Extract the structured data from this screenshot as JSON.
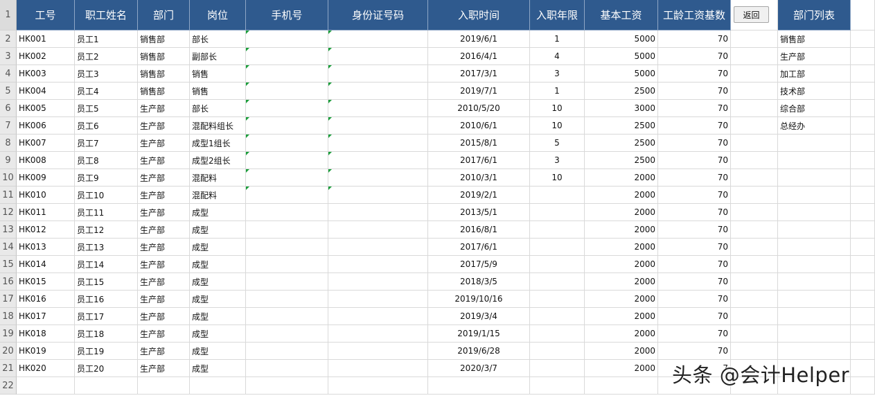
{
  "headers": [
    "工号",
    "职工姓名",
    "部门",
    "岗位",
    "手机号",
    "身份证号码",
    "入职时间",
    "入职年限",
    "基本工资",
    "工龄工资基数",
    "",
    "部门列表"
  ],
  "return_button": "返回",
  "row_numbers": [
    "1",
    "2",
    "3",
    "4",
    "5",
    "6",
    "7",
    "8",
    "9",
    "10",
    "11",
    "12",
    "13",
    "14",
    "15",
    "16",
    "17",
    "18",
    "19",
    "20",
    "21",
    "22"
  ],
  "rows": [
    {
      "id": "HK001",
      "name": "员工1",
      "dept": "销售部",
      "post": "部长",
      "phone": "",
      "idcard": "",
      "date": "2019/6/1",
      "years": "1",
      "salary": "5000",
      "base": "70"
    },
    {
      "id": "HK002",
      "name": "员工2",
      "dept": "销售部",
      "post": "副部长",
      "phone": "",
      "idcard": "",
      "date": "2016/4/1",
      "years": "4",
      "salary": "5000",
      "base": "70"
    },
    {
      "id": "HK003",
      "name": "员工3",
      "dept": "销售部",
      "post": "销售",
      "phone": "",
      "idcard": "",
      "date": "2017/3/1",
      "years": "3",
      "salary": "5000",
      "base": "70"
    },
    {
      "id": "HK004",
      "name": "员工4",
      "dept": "销售部",
      "post": "销售",
      "phone": "",
      "idcard": "",
      "date": "2019/7/1",
      "years": "1",
      "salary": "2500",
      "base": "70"
    },
    {
      "id": "HK005",
      "name": "员工5",
      "dept": "生产部",
      "post": "部长",
      "phone": "",
      "idcard": "",
      "date": "2010/5/20",
      "years": "10",
      "salary": "3000",
      "base": "70"
    },
    {
      "id": "HK006",
      "name": "员工6",
      "dept": "生产部",
      "post": "混配料组长",
      "phone": "",
      "idcard": "",
      "date": "2010/6/1",
      "years": "10",
      "salary": "2500",
      "base": "70"
    },
    {
      "id": "HK007",
      "name": "员工7",
      "dept": "生产部",
      "post": "成型1组长",
      "phone": "",
      "idcard": "",
      "date": "2015/8/1",
      "years": "5",
      "salary": "2500",
      "base": "70"
    },
    {
      "id": "HK008",
      "name": "员工8",
      "dept": "生产部",
      "post": "成型2组长",
      "phone": "",
      "idcard": "",
      "date": "2017/6/1",
      "years": "3",
      "salary": "2500",
      "base": "70"
    },
    {
      "id": "HK009",
      "name": "员工9",
      "dept": "生产部",
      "post": "混配料",
      "phone": "",
      "idcard": "",
      "date": "2010/3/1",
      "years": "10",
      "salary": "2000",
      "base": "70"
    },
    {
      "id": "HK010",
      "name": "员工10",
      "dept": "生产部",
      "post": "混配料",
      "phone": "",
      "idcard": "",
      "date": "2019/2/1",
      "years": "",
      "salary": "2000",
      "base": "70"
    },
    {
      "id": "HK011",
      "name": "员工11",
      "dept": "生产部",
      "post": "成型",
      "phone": "",
      "idcard": "",
      "date": "2013/5/1",
      "years": "",
      "salary": "2000",
      "base": "70"
    },
    {
      "id": "HK012",
      "name": "员工12",
      "dept": "生产部",
      "post": "成型",
      "phone": "",
      "idcard": "",
      "date": "2016/8/1",
      "years": "",
      "salary": "2000",
      "base": "70"
    },
    {
      "id": "HK013",
      "name": "员工13",
      "dept": "生产部",
      "post": "成型",
      "phone": "",
      "idcard": "",
      "date": "2017/6/1",
      "years": "",
      "salary": "2000",
      "base": "70"
    },
    {
      "id": "HK014",
      "name": "员工14",
      "dept": "生产部",
      "post": "成型",
      "phone": "",
      "idcard": "",
      "date": "2017/5/9",
      "years": "",
      "salary": "2000",
      "base": "70"
    },
    {
      "id": "HK015",
      "name": "员工15",
      "dept": "生产部",
      "post": "成型",
      "phone": "",
      "idcard": "",
      "date": "2018/3/5",
      "years": "",
      "salary": "2000",
      "base": "70"
    },
    {
      "id": "HK016",
      "name": "员工16",
      "dept": "生产部",
      "post": "成型",
      "phone": "",
      "idcard": "",
      "date": "2019/10/16",
      "years": "",
      "salary": "2000",
      "base": "70"
    },
    {
      "id": "HK017",
      "name": "员工17",
      "dept": "生产部",
      "post": "成型",
      "phone": "",
      "idcard": "",
      "date": "2019/3/4",
      "years": "",
      "salary": "2000",
      "base": "70"
    },
    {
      "id": "HK018",
      "name": "员工18",
      "dept": "生产部",
      "post": "成型",
      "phone": "",
      "idcard": "",
      "date": "2019/1/15",
      "years": "",
      "salary": "2000",
      "base": "70"
    },
    {
      "id": "HK019",
      "name": "员工19",
      "dept": "生产部",
      "post": "成型",
      "phone": "",
      "idcard": "",
      "date": "2019/6/28",
      "years": "",
      "salary": "2000",
      "base": "70"
    },
    {
      "id": "HK020",
      "name": "员工20",
      "dept": "生产部",
      "post": "成型",
      "phone": "",
      "idcard": "",
      "date": "2020/3/7",
      "years": "",
      "salary": "2000",
      "base": "7"
    }
  ],
  "dept_list": [
    "销售部",
    "生产部",
    "加工部",
    "技术部",
    "综合部",
    "总经办"
  ],
  "watermark": "头条 @会计Helper",
  "colors": {
    "header_bg": "#2f5a8e",
    "header_text": "#ffffff",
    "text_marker": "#1a9e3a"
  }
}
